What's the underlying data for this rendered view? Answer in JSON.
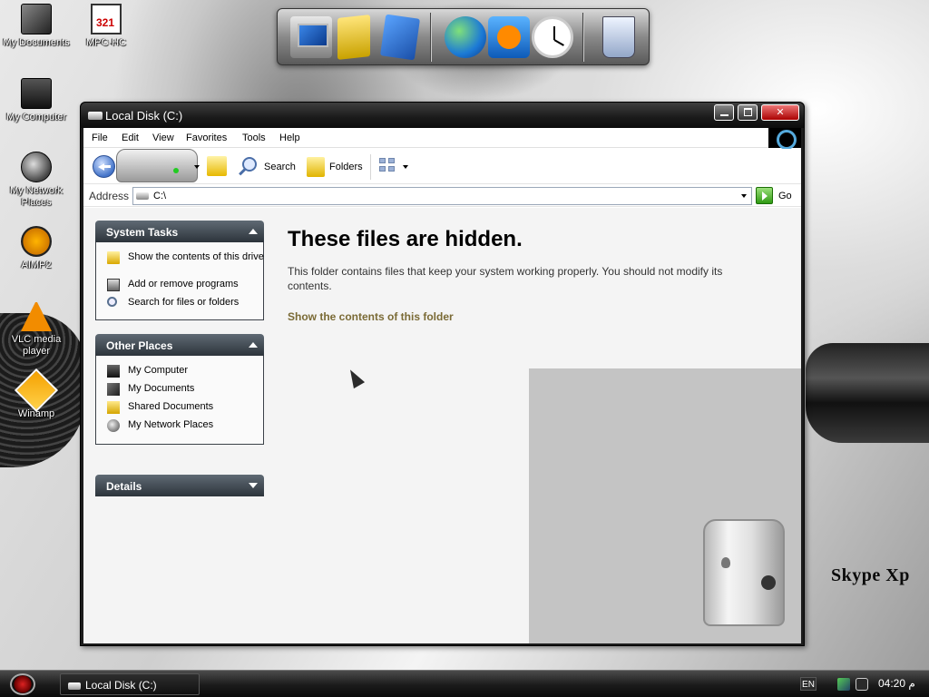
{
  "desktop": {
    "icons": [
      {
        "label": "My Documents",
        "icon": "my-documents-icon"
      },
      {
        "label": "MPC-HC",
        "icon": "mpc-hc-icon"
      },
      {
        "label": "My Computer",
        "icon": "my-computer-icon"
      },
      {
        "label": "My Network Places",
        "icon": "network-places-icon"
      },
      {
        "label": "AIMP2",
        "icon": "aimp-icon"
      },
      {
        "label": "VLC media player",
        "icon": "vlc-icon"
      },
      {
        "label": "Winamp",
        "icon": "winamp-icon"
      }
    ],
    "brand_text": "Skype Xp"
  },
  "dock": {
    "items": [
      "computer-icon",
      "folder-icon",
      "documents-icon",
      "browser-globe-icon",
      "media-player-icon",
      "clock-icon",
      "recycle-bin-icon"
    ]
  },
  "window": {
    "title": "Local Disk (C:)",
    "menu": [
      "File",
      "Edit",
      "View",
      "Favorites",
      "Tools",
      "Help"
    ],
    "toolbar": {
      "search_label": "Search",
      "folders_label": "Folders"
    },
    "address": {
      "label": "Address",
      "value": "C:\\",
      "go_label": "Go"
    },
    "taskpane": {
      "system_tasks": {
        "title": "System Tasks",
        "items": [
          "Show the contents of this drive",
          "Add or remove programs",
          "Search for files or folders"
        ]
      },
      "other_places": {
        "title": "Other Places",
        "items": [
          "My Computer",
          "My Documents",
          "Shared Documents",
          "My Network Places"
        ]
      },
      "details": {
        "title": "Details"
      }
    },
    "main": {
      "heading": "These files are hidden.",
      "description": "This folder contains files that keep your system working properly. You should not modify its contents.",
      "link": "Show the contents of this folder"
    }
  },
  "taskbar": {
    "task_label": "Local Disk (C:)",
    "language": "EN",
    "clock": "04:20 م"
  },
  "colors": {
    "taskpane_header": "#2d343b",
    "link": "#7a6a35",
    "taskbar": "#1b1b1b"
  }
}
